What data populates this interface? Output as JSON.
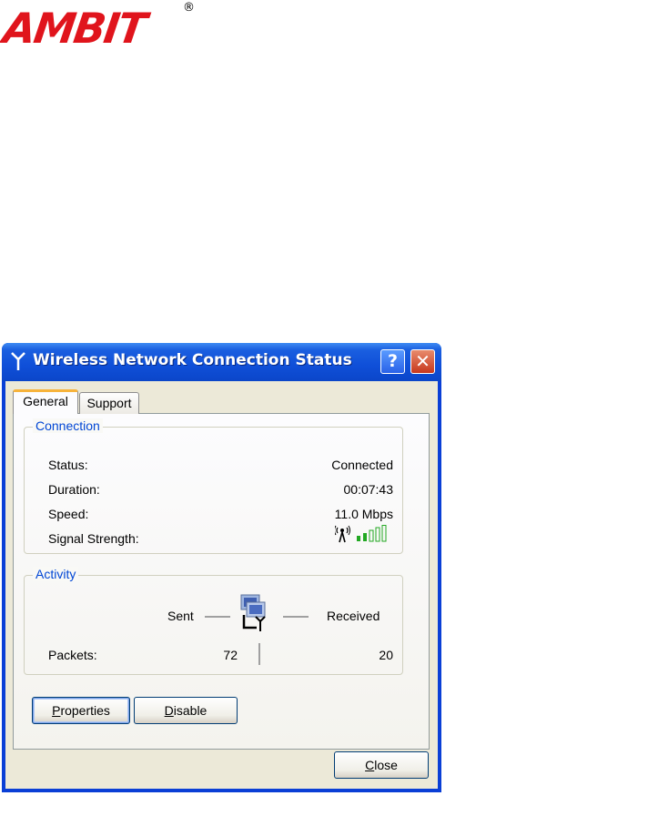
{
  "logo": {
    "text": "AMBIT",
    "registered": "®"
  },
  "window": {
    "title": "Wireless Network Connection Status",
    "help_glyph": "?",
    "close_glyph": "✕"
  },
  "tabs": [
    {
      "label": "General",
      "selected": true
    },
    {
      "label": "Support",
      "selected": false
    }
  ],
  "connection": {
    "group_label": "Connection",
    "rows": [
      {
        "label": "Status:",
        "value": "Connected"
      },
      {
        "label": "Duration:",
        "value": "00:07:43"
      },
      {
        "label": "Speed:",
        "value": "11.0 Mbps"
      },
      {
        "label": "Signal Strength:",
        "value": ""
      }
    ],
    "signal_bars": {
      "filled": 2,
      "total": 5
    }
  },
  "activity": {
    "group_label": "Activity",
    "sent_label": "Sent",
    "received_label": "Received",
    "packets_label": "Packets:",
    "packets_sent": "72",
    "packets_received": "20"
  },
  "buttons": {
    "properties": {
      "prefix": "",
      "accel": "P",
      "rest": "roperties"
    },
    "disable": {
      "prefix": "",
      "accel": "D",
      "rest": "isable"
    },
    "close": {
      "prefix": "",
      "accel": "C",
      "rest": "lose"
    }
  },
  "icons": {
    "title": "antenna-icon",
    "signal": "wireless-signal-icon",
    "activity": "network-computers-icon"
  },
  "colors": {
    "titlebar": "#0f4fd8",
    "dialog_bg": "#ece9d8",
    "group_label": "#0046d5",
    "signal_green": "#22a822",
    "logo_red": "#e0141c",
    "tab_highlight": "#f7b33a"
  }
}
